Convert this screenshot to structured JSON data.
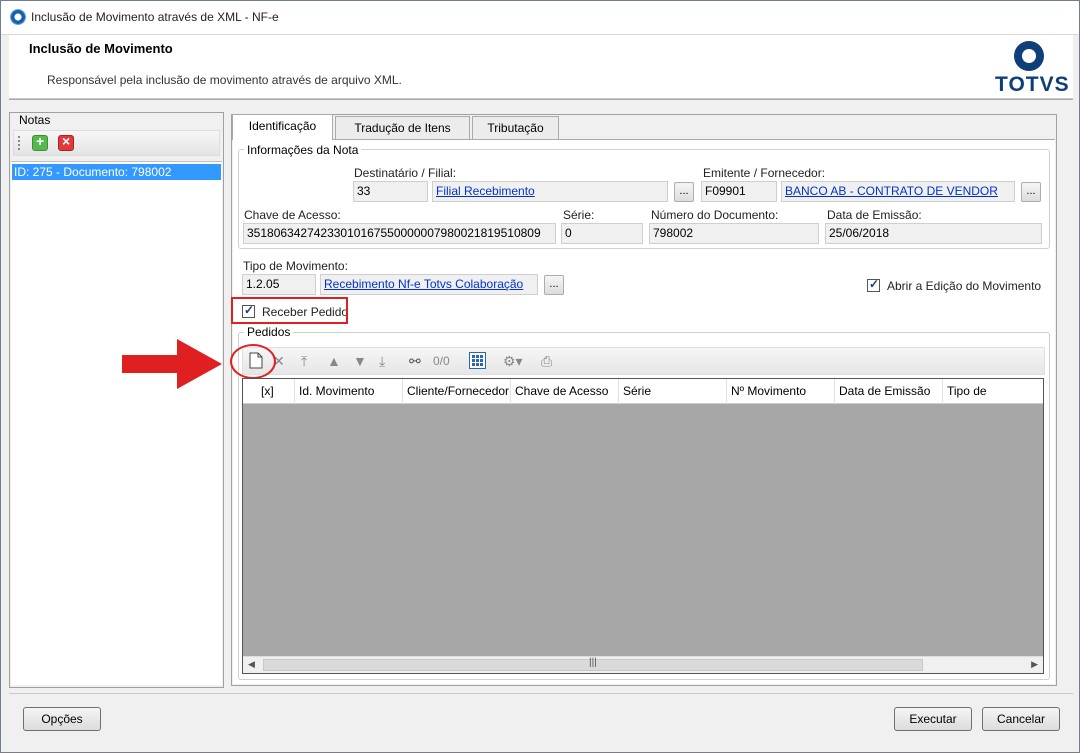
{
  "window": {
    "title": "Inclusão de Movimento através de XML - NF-e"
  },
  "header": {
    "title": "Inclusão de Movimento",
    "subtitle": "Responsável pela inclusão de movimento através de arquivo XML.",
    "logo_text": "TOTVS"
  },
  "notas": {
    "label": "Notas",
    "items": [
      "ID: 275 - Documento: 798002"
    ]
  },
  "tabs": [
    "Identificação",
    "Tradução de Itens",
    "Tributação"
  ],
  "info": {
    "group_label": "Informações da Nota",
    "destinatario_label": "Destinatário / Filial:",
    "destinatario_code": "33",
    "destinatario_name": "Filial Recebimento",
    "emitente_label": "Emitente / Fornecedor:",
    "emitente_code": "F09901",
    "emitente_name": "BANCO AB -  CONTRATO DE VENDOR",
    "chave_label": "Chave de Acesso:",
    "chave_value": "35180634274233010167550000007980021819510809",
    "serie_label": "Série:",
    "serie_value": "0",
    "numero_label": "Número do Documento:",
    "numero_value": "798002",
    "data_label": "Data de Emissão:",
    "data_value": "25/06/2018",
    "ellipsis": "..."
  },
  "tipo": {
    "label": "Tipo de Movimento:",
    "code": "1.2.05",
    "name": "Recebimento Nf-e Totvs Colaboração"
  },
  "abrir_label": "Abrir a Edição do Movimento",
  "receber_label": "Receber Pedido",
  "pedidos": {
    "label": "Pedidos",
    "counter": "0/0",
    "columns": [
      "[x]",
      "Id. Movimento",
      "Cliente/Fornecedor",
      "Chave de Acesso",
      "Série",
      "Nº Movimento",
      "Data de Emissão",
      "Tipo de"
    ]
  },
  "buttons": {
    "opcoes": "Opções",
    "executar": "Executar",
    "cancelar": "Cancelar"
  },
  "colors": {
    "selection": "#3399ff",
    "annotation": "#e02020",
    "link": "#0033cc",
    "brand": "#0f3f78"
  }
}
